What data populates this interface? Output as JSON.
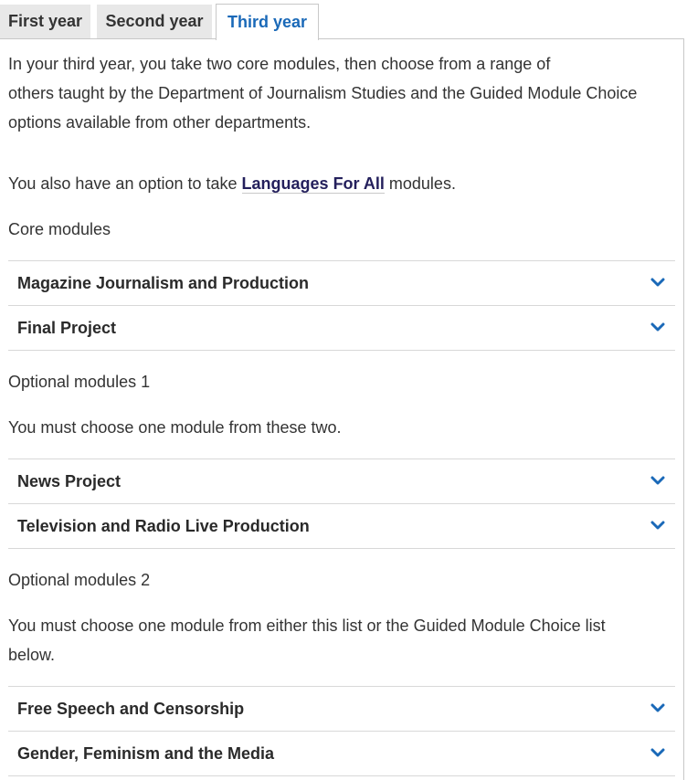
{
  "tabs": [
    {
      "label": "First year"
    },
    {
      "label": "Second year"
    },
    {
      "label": "Third year"
    }
  ],
  "intro": {
    "line1": "In your third year, you take two core modules, then choose from a range of",
    "line2": "others taught by the Department of Journalism Studies and the Guided Module Choice",
    "line3": "options available from other departments."
  },
  "languages": {
    "prefix": "You also have an option to take ",
    "link": "Languages For All",
    "suffix": " modules."
  },
  "core": {
    "heading": "Core modules",
    "modules": [
      "Magazine Journalism and Production",
      "Final Project"
    ]
  },
  "optional1": {
    "heading": "Optional modules 1",
    "instruction": "You must choose one module from these two.",
    "modules": [
      "News Project",
      "Television and Radio Live Production"
    ]
  },
  "optional2": {
    "heading": "Optional modules 2",
    "instruction_line1": "You must choose one module from either this list or the Guided Module Choice list",
    "instruction_line2": "below.",
    "modules": [
      "Free Speech and Censorship",
      "Gender, Feminism and the Media"
    ]
  },
  "colors": {
    "active_tab": "#1a69b8",
    "link": "#24205c",
    "chevron": "#1a69b8"
  },
  "icons": {
    "accordion_toggle": "chevron-down-icon"
  }
}
